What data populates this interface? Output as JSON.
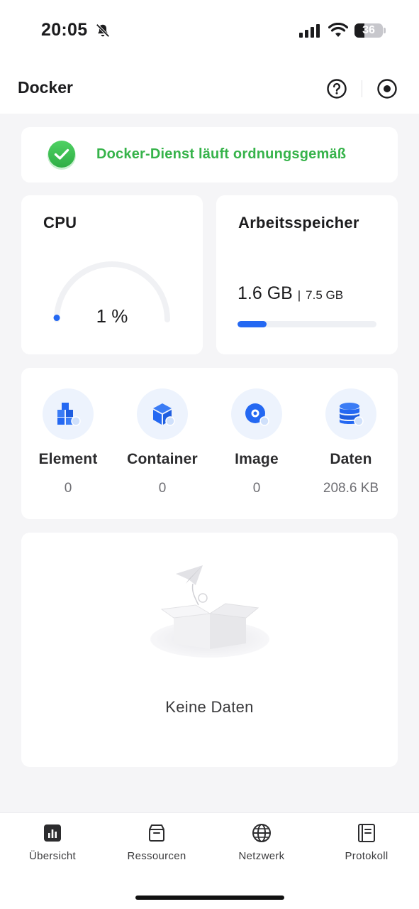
{
  "status_bar": {
    "time": "20:05",
    "battery": "36"
  },
  "header": {
    "title": "Docker",
    "help_icon": "question-circle-icon",
    "record_icon": "record-circle-icon"
  },
  "service_status": {
    "text": "Docker-Dienst läuft ordnungsgemäß",
    "color": "#36b34a"
  },
  "cpu": {
    "title": "CPU",
    "value": "1 %",
    "percent": 1
  },
  "memory": {
    "title": "Arbeitsspeicher",
    "used": "1.6 GB",
    "separator": "|",
    "total": "7.5 GB",
    "fraction": 0.21
  },
  "stats": [
    {
      "label": "Element",
      "value": "0",
      "icon": "cubes-icon"
    },
    {
      "label": "Container",
      "value": "0",
      "icon": "container-box-icon"
    },
    {
      "label": "Image",
      "value": "0",
      "icon": "disc-image-icon"
    },
    {
      "label": "Daten",
      "value": "208.6 KB",
      "icon": "database-icon"
    }
  ],
  "empty_state": {
    "text": "Keine Daten"
  },
  "tabs": [
    {
      "label": "Übersicht",
      "icon": "chart-icon"
    },
    {
      "label": "Ressourcen",
      "icon": "archive-icon"
    },
    {
      "label": "Netzwerk",
      "icon": "globe-icon"
    },
    {
      "label": "Protokoll",
      "icon": "log-book-icon"
    }
  ],
  "colors": {
    "accent": "#2468f2",
    "success": "#36b34a"
  }
}
